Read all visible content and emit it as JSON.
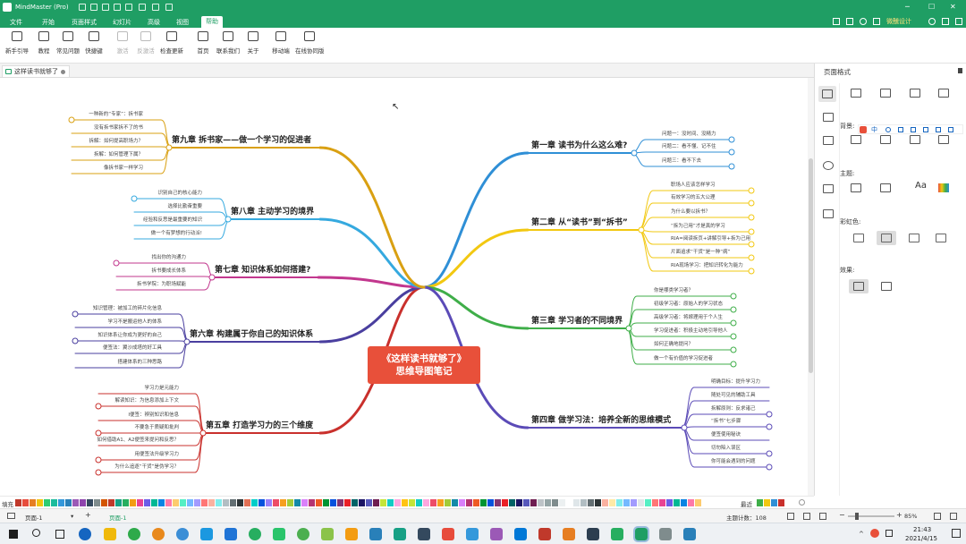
{
  "app": {
    "title": "MindMaster (Pro)",
    "account_label": "微醺设计",
    "colors": {
      "brand": "#1f9e64",
      "center_topic": "#e8503a"
    }
  },
  "menu": {
    "items": [
      "文件",
      "开始",
      "页面样式",
      "幻灯片",
      "高级",
      "视图",
      "帮助"
    ],
    "active": "帮助"
  },
  "ribbon": {
    "buttons": [
      {
        "label": "新手引导",
        "icon": "guide-icon",
        "enabled": true
      },
      {
        "label": "教程",
        "icon": "tutorial-icon",
        "enabled": true
      },
      {
        "label": "常见问题",
        "icon": "faq-icon",
        "enabled": true
      },
      {
        "label": "快捷键",
        "icon": "keyboard-icon",
        "enabled": true
      },
      {
        "label": "激活",
        "icon": "lock-icon",
        "enabled": false
      },
      {
        "label": "反激活",
        "icon": "unlock-icon",
        "enabled": false
      },
      {
        "label": "检查更新",
        "icon": "update-icon",
        "enabled": true
      },
      {
        "label": "首页",
        "icon": "home-icon",
        "enabled": true
      },
      {
        "label": "联系我们",
        "icon": "contact-icon",
        "enabled": true
      },
      {
        "label": "关于",
        "icon": "about-icon",
        "enabled": true
      },
      {
        "label": "移动端",
        "icon": "mobile-icon",
        "enabled": true
      },
      {
        "label": "在线协同版",
        "icon": "online-icon",
        "enabled": true
      }
    ]
  },
  "document": {
    "tab_title": "这样读书就够了"
  },
  "mindmap": {
    "center": {
      "line1": "《这样读书就够了》",
      "line2": "思维导图笔记"
    },
    "branches": [
      {
        "title": "第一章 读书为什么这么难?",
        "color": "#2f8fd6",
        "subs": [
          "问题一：没时间、没精力",
          "问题二：看不懂、记不住",
          "问题三：看不下去"
        ]
      },
      {
        "title": "第二章 从“读书”到“拆书”",
        "color": "#f2c811",
        "subs": [
          "职场人应该怎样学习",
          "有效学习的五大公理",
          "为什么要以拆书？",
          "“拆为己用”才是真的学习",
          "RIA=阅读拆页+讲解引导+拆为己用",
          "片面追求“干货”是一种“病”",
          "RIA现场学习：把知识转化为能力"
        ]
      },
      {
        "title": "第三章 学习者的不同境界",
        "color": "#3fae49",
        "subs": [
          "你是哪类学习者？",
          "初级学习者：原始人的学习状态",
          "高级学习者：将嫁理用于个人生",
          "学习促进者：积极主动地引导他人",
          "如何正确地提问？",
          "做一个有价值的学习促进者"
        ]
      },
      {
        "title": "第四章 做学习法：培养全新的思维模式",
        "color": "#5b4bb7",
        "subs": [
          "明确目标：提升学习力",
          "随处可见的辅助工具",
          "拆解原则：反求诸己",
          "“拆书”七步骤",
          "便签使用秘诀",
          "切勿陷入误区",
          "你可能会遇到的问题"
        ]
      },
      {
        "title": "第五章 打造学习力的三个维度",
        "color": "#c9302c",
        "subs": [
          "学习力是元能力",
          "解读知识：为信息添加上下文",
          "I便签：辨别知识和信息",
          "不要急于质疑和批判",
          "如何借助A1、A2便签来提问和反思？",
          "用便签法升级学习力",
          "为什么追逐“干货”是伪学习？"
        ]
      },
      {
        "title": "第六章 构建属于你自己的知识体系",
        "color": "#4a3f9f",
        "subs": [
          "知识管理：被加工的碎片化信息",
          "学习不是搬运他人的体系",
          "知识体系让你成为更好的自己",
          "便签法：翼沙成塔的好工具",
          "搭建体系的三种思路"
        ]
      },
      {
        "title": "第七章 知识体系如何搭建?",
        "color": "#c2378e",
        "subs": [
          "找出你的沟通力",
          "拆书要成长体系",
          "拆书学院：为职场赋能"
        ]
      },
      {
        "title": "第八章 主动学习的境界",
        "color": "#35a9df",
        "subs": [
          "识别自己的核心能力",
          "选择比勤奋重要",
          "经验和反思是最重要的知识",
          "做一个有梦想的行动派!"
        ]
      },
      {
        "title": "第九章 拆书家——做一个学习的促进者",
        "color": "#d9a012",
        "subs": [
          "一种新的“专家”：拆书家",
          "没有拆书家拆不了的书",
          "拆解：如何提高职场力？",
          "拆解：如何管理下属？",
          "像拆书家一样学习"
        ]
      }
    ]
  },
  "right_panel": {
    "title": "页面格式",
    "background_label": "背景:",
    "theme_label": "主题:",
    "rainbow_label": "彩虹色:",
    "effect_label": "效果:",
    "font_button": "Aa"
  },
  "palette": {
    "fill_label": "填充",
    "recent_label": "最近",
    "colors": [
      "#c0392b",
      "#e74c3c",
      "#e67e22",
      "#f1c40f",
      "#2ecc71",
      "#1abc9c",
      "#3498db",
      "#2980b9",
      "#9b59b6",
      "#8e44ad",
      "#34495e",
      "#7f8c8d",
      "#d35400",
      "#c0392b",
      "#16a085",
      "#27ae60",
      "#f39c12",
      "#e84393",
      "#6c5ce7",
      "#00b894",
      "#0984e3",
      "#fd79a8",
      "#fdcb6e",
      "#55efc4",
      "#74b9ff",
      "#a29bfe",
      "#ff7675",
      "#fab1a0",
      "#81ecec",
      "#b2bec3",
      "#636e72",
      "#2d3436",
      "#e17055",
      "#00cec9",
      "#0652dd",
      "#9980fa",
      "#ed4c67",
      "#f79f1f",
      "#a3cb38",
      "#1289a7",
      "#d980fa",
      "#b53471",
      "#ee5a24",
      "#009432",
      "#0652dd",
      "#833471",
      "#ea2027",
      "#006266",
      "#1b1464",
      "#5758bb",
      "#6f1e51",
      "#c4e538",
      "#12cbc4",
      "#fda7df",
      "#ffc312",
      "#c4e538",
      "#12cbc4",
      "#fda7df",
      "#ed4c67",
      "#f79f1f",
      "#a3cb38",
      "#1289a7",
      "#d980fa",
      "#b53471",
      "#ee5a24",
      "#009432",
      "#0652dd",
      "#833471",
      "#ea2027",
      "#006266",
      "#1b1464",
      "#5758bb",
      "#6f1e51",
      "#bdc3c7",
      "#95a5a6",
      "#7f8c8d",
      "#ecf0f1",
      "#ffffff",
      "#dfe6e9",
      "#b2bec3",
      "#636e72",
      "#2d3436",
      "#fab1a0",
      "#ffeaa7",
      "#81ecec",
      "#74b9ff",
      "#a29bfe",
      "#dfe6e9",
      "#55efc4",
      "#ff7675",
      "#e84393",
      "#6c5ce7",
      "#00b894",
      "#0984e3",
      "#fd79a8",
      "#fdcb6e"
    ]
  },
  "status": {
    "page_selector": "页面-1",
    "page_tab": "页面-1",
    "topic_count": "主题计数：108",
    "zoom": "85%"
  },
  "taskbar": {
    "time": "21:43",
    "date": "2021/4/15"
  }
}
